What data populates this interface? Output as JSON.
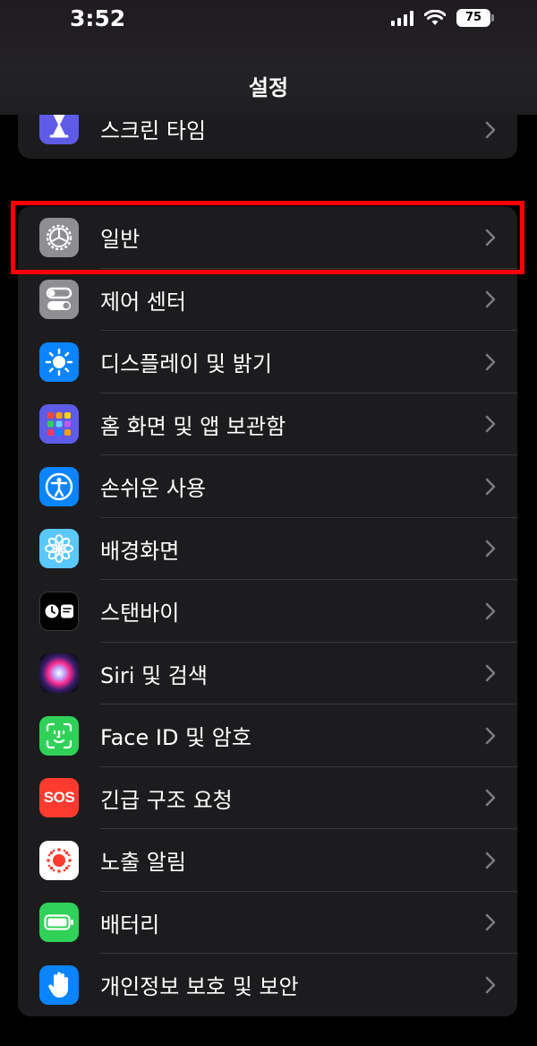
{
  "status_bar": {
    "time": "3:52",
    "battery": "75"
  },
  "header": {
    "title": "설정"
  },
  "top_group": [
    {
      "label": "스크린 타임",
      "icon": "hourglass-icon",
      "color": "#5e5ce6"
    }
  ],
  "main_group": [
    {
      "label": "일반",
      "icon": "gear-icon",
      "color": "#8e8e93"
    },
    {
      "label": "제어 센터",
      "icon": "toggle-switches-icon",
      "color": "#8e8e93"
    },
    {
      "label": "디스플레이 및 밝기",
      "icon": "sun-icon",
      "color": "#0a84ff"
    },
    {
      "label": "홈 화면 및 앱 보관함",
      "icon": "app-grid-icon",
      "color": "#5e5ce6"
    },
    {
      "label": "손쉬운 사용",
      "icon": "accessibility-icon",
      "color": "#0a84ff"
    },
    {
      "label": "배경화면",
      "icon": "flower-icon",
      "color": "#5ac8fa"
    },
    {
      "label": "스탠바이",
      "icon": "standby-icon",
      "color": "#000000"
    },
    {
      "label": "Siri 및 검색",
      "icon": "siri-icon",
      "color": "#1a1a2e"
    },
    {
      "label": "Face ID 및 암호",
      "icon": "face-id-icon",
      "color": "#30d158"
    },
    {
      "label": "긴급 구조 요청",
      "icon": "sos-icon",
      "color": "#ff3b30",
      "icon_text": "SOS"
    },
    {
      "label": "노출 알림",
      "icon": "exposure-notification-icon",
      "color": "#ffffff"
    },
    {
      "label": "배터리",
      "icon": "battery-icon",
      "color": "#30d158"
    },
    {
      "label": "개인정보 보호 및 보안",
      "icon": "hand-icon",
      "color": "#0a84ff"
    }
  ],
  "highlight_color": "#ff0000"
}
